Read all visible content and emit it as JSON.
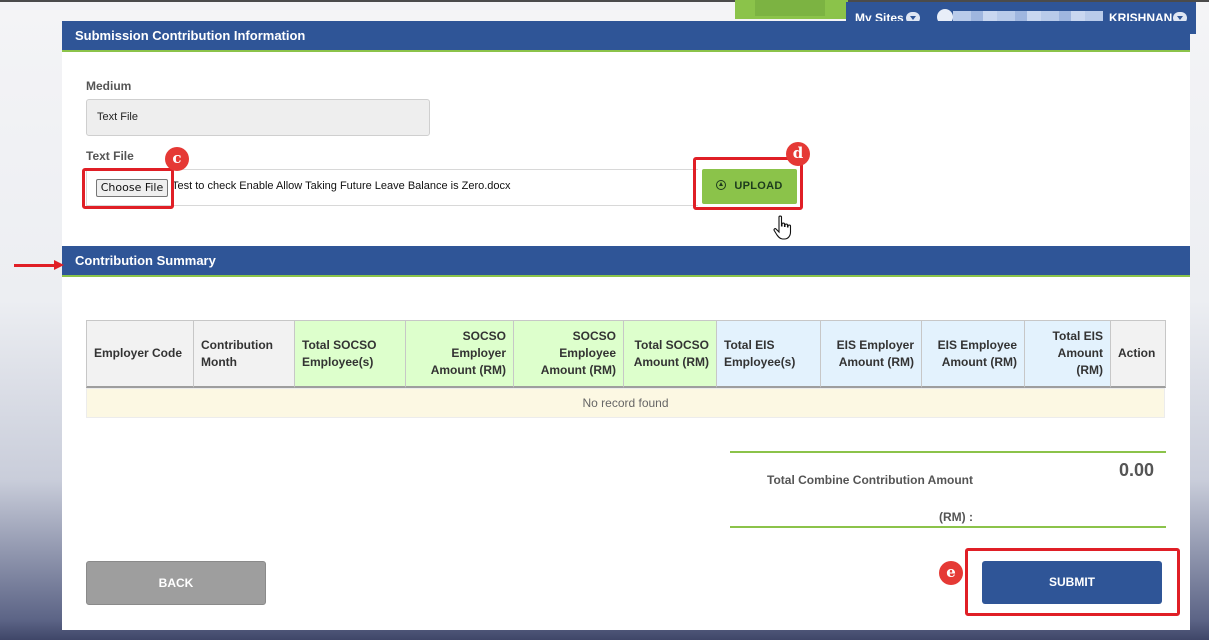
{
  "topnav": {
    "my_sites": "My Sites",
    "username": "KRISHNAN"
  },
  "submission": {
    "title": "Submission Contribution Information",
    "medium_label": "Medium",
    "medium_value": "Text File",
    "textfile_label": "Text File",
    "choose_file": "Choose File",
    "file_name": "Test to check Enable Allow Taking Future Leave Balance is Zero.docx",
    "upload": "UPLOAD"
  },
  "annotations": {
    "c": "c",
    "d": "d",
    "e": "e"
  },
  "summary": {
    "title": "Contribution Summary",
    "columns": [
      "Employer Code",
      "Contribution Month",
      "Total SOCSO Employee(s)",
      "SOCSO Employer Amount (RM)",
      "SOCSO Employee Amount (RM)",
      "Total SOCSO Amount (RM)",
      "Total EIS Employee(s)",
      "EIS Employer Amount (RM)",
      "EIS Employee Amount (RM)",
      "Total EIS Amount (RM)",
      "Action"
    ],
    "no_record": "No record found",
    "total_label": "Total Combine Contribution Amount",
    "total_unit": "(RM) :",
    "total_value": "0.00"
  },
  "actions": {
    "back": "BACK",
    "submit": "SUBMIT"
  },
  "colors": {
    "header_blue": "#2f5597",
    "accent_green": "#8bc34a",
    "annotation_red": "#e01f26"
  }
}
